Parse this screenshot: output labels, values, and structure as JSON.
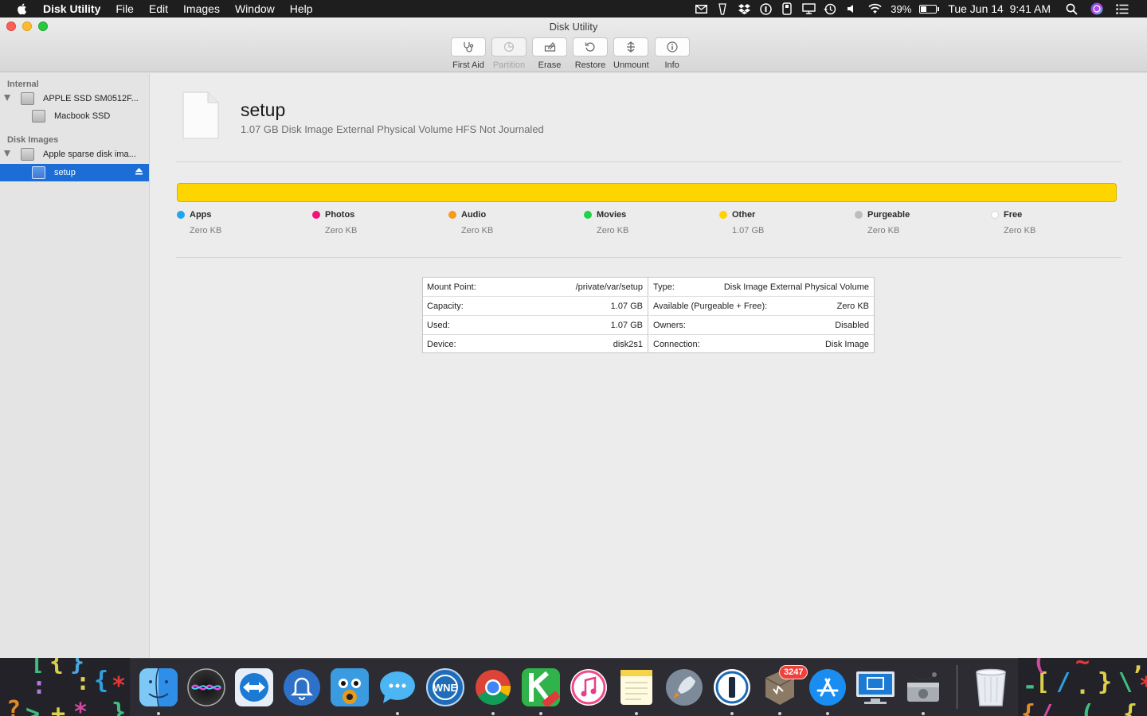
{
  "menubar": {
    "app_name": "Disk Utility",
    "menus": [
      "File",
      "Edit",
      "Images",
      "Window",
      "Help"
    ],
    "status_icons": [
      "mail-icon",
      "vpn-icon",
      "dropbox-icon",
      "1password-icon",
      "usb-icon",
      "screen-icon",
      "time-machine-icon",
      "volume-icon",
      "wifi-icon"
    ],
    "battery_percent": "39%",
    "battery_level": 0.39,
    "datetime": "Tue Jun 14  9:41 AM"
  },
  "window": {
    "title": "Disk Utility",
    "toolbar": [
      {
        "label": "First Aid",
        "icon": "stethoscope-icon",
        "enabled": true
      },
      {
        "label": "Partition",
        "icon": "pie-chart-icon",
        "enabled": false
      },
      {
        "label": "Erase",
        "icon": "erase-icon",
        "enabled": true
      },
      {
        "label": "Restore",
        "icon": "restore-icon",
        "enabled": true
      },
      {
        "label": "Unmount",
        "icon": "unmount-icon",
        "enabled": true
      },
      {
        "label": "Info",
        "icon": "info-icon",
        "enabled": true
      }
    ]
  },
  "sidebar": {
    "internal_header": "Internal",
    "internal_disk": "APPLE SSD SM0512F...",
    "internal_volume": "Macbook SSD",
    "images_header": "Disk Images",
    "image_disk": "Apple sparse disk ima...",
    "image_volume": "setup"
  },
  "volume": {
    "name": "setup",
    "description": "1.07 GB Disk Image External Physical Volume HFS Not Journaled"
  },
  "usage": {
    "bar_color": "#FFD500",
    "legend": [
      {
        "name": "Apps",
        "value": "Zero KB",
        "color": "#1EA7F0"
      },
      {
        "name": "Photos",
        "value": "Zero KB",
        "color": "#F0147A"
      },
      {
        "name": "Audio",
        "value": "Zero KB",
        "color": "#F59B16"
      },
      {
        "name": "Movies",
        "value": "Zero KB",
        "color": "#20D14A"
      },
      {
        "name": "Other",
        "value": "1.07 GB",
        "color": "#FFD200"
      },
      {
        "name": "Purgeable",
        "value": "Zero KB",
        "color": "#BDBDBD"
      },
      {
        "name": "Free",
        "value": "Zero KB",
        "color": "#FFFFFF"
      }
    ]
  },
  "info": {
    "left": [
      {
        "key": "Mount Point:",
        "value": "/private/var/setup"
      },
      {
        "key": "Capacity:",
        "value": "1.07 GB"
      },
      {
        "key": "Used:",
        "value": "1.07 GB"
      },
      {
        "key": "Device:",
        "value": "disk2s1"
      }
    ],
    "right": [
      {
        "key": "Type:",
        "value": "Disk Image External Physical Volume"
      },
      {
        "key": "Available (Purgeable + Free):",
        "value": "Zero KB"
      },
      {
        "key": "Owners:",
        "value": "Disabled"
      },
      {
        "key": "Connection:",
        "value": "Disk Image"
      }
    ]
  },
  "dock": {
    "apps": [
      {
        "name": "finder",
        "running": true
      },
      {
        "name": "siri",
        "running": false
      },
      {
        "name": "teamviewer",
        "running": false
      },
      {
        "name": "notification-app",
        "running": false
      },
      {
        "name": "tweetbot",
        "running": false
      },
      {
        "name": "messages",
        "running": true
      },
      {
        "name": "network-radar",
        "running": false
      },
      {
        "name": "chrome",
        "running": true
      },
      {
        "name": "kiwi-beta",
        "running": true
      },
      {
        "name": "itunes",
        "running": false
      },
      {
        "name": "notes",
        "running": true
      },
      {
        "name": "launchpad",
        "running": false
      },
      {
        "name": "1password",
        "running": true
      },
      {
        "name": "airmail",
        "running": true,
        "badge": "3247"
      },
      {
        "name": "app-store",
        "running": true
      },
      {
        "name": "screen-sharing",
        "running": false
      },
      {
        "name": "disk-utility",
        "running": true
      }
    ],
    "trash": "trash"
  }
}
